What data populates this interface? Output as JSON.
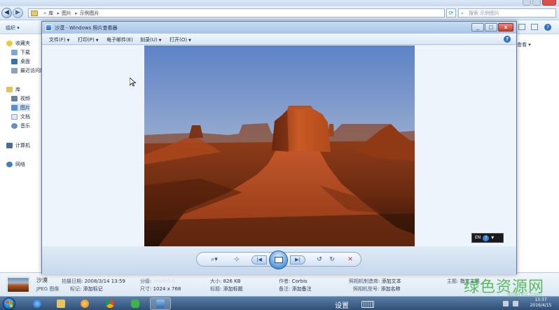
{
  "explorer": {
    "breadcrumb": [
      "库",
      "图片",
      "示例图片"
    ],
    "search_placeholder": "搜索 示例图片",
    "toolbar": {
      "organize": "组织 ▾",
      "views": "≡ ▾"
    },
    "nav": {
      "favorites": "收藏夹",
      "downloads": "下载",
      "desktop": "桌面",
      "recent": "最近访问的",
      "libraries": "库",
      "videos": "视频",
      "pictures": "图片",
      "documents": "文档",
      "music": "音乐",
      "computer": "计算机",
      "network": "网络"
    },
    "details": {
      "title": "沙漠",
      "type": "JPEG 图像",
      "date_label": "拍摄日期:",
      "date_value": "2008/3/14 13:59",
      "tags_label": "标记:",
      "tags_value": "添加标记",
      "rating_label": "分级:",
      "rating_value": 0,
      "rating_max": 5,
      "dimensions_label": "尺寸:",
      "dimensions_value": "1024 x 768",
      "size_label": "大小:",
      "size_value": "826 KB",
      "heading_label": "标题:",
      "heading_value": "添加标题",
      "author_label": "作者:",
      "author_value": "Corbis",
      "comment_label": "备注:",
      "comment_value": "添加备注",
      "maker_label": "照相机制造商:",
      "maker_value": "添加文本",
      "model_label": "照相机型号:",
      "model_value": "添加名称",
      "subject_label": "主题:",
      "subject_value": "指定主题"
    },
    "view_label": "查看 ▾"
  },
  "viewer": {
    "title": "沙漠 - Windows 照片查看器",
    "menus": [
      "文件(F)",
      "打印(P)",
      "电子邮件(E)",
      "刻录(U)",
      "打开(O)"
    ],
    "help": "?",
    "lang_bar": "EN",
    "controls": {
      "zoom": "⌕▾",
      "fit": "⊹",
      "prev": "|◀",
      "next": "▶|",
      "rotate_ccw": "↺",
      "rotate_cw": "↻",
      "delete": "✕"
    }
  },
  "taskbar": {
    "settings_label": "设置",
    "clock_time": "13:37",
    "clock_date": "2016/4/15"
  },
  "watermark": {
    "main": "绿色资源网",
    "sub": "downcc.com"
  },
  "colors": {
    "sky_top": "#6d8fcf",
    "sky_bottom": "#c6c9cf",
    "rock": "#a8461c",
    "accent_blue": "#2f6fc5",
    "watermark_green": "#4cb84f"
  }
}
